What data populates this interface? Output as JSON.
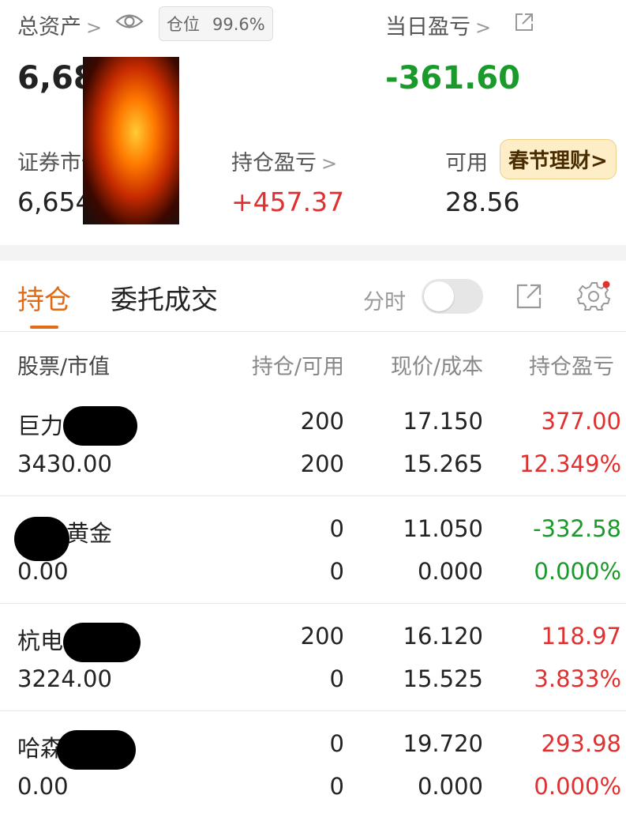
{
  "summary": {
    "total_assets_label": "总资产",
    "total_assets_value": "6,68",
    "position_label": "仓位",
    "position_value": "99.6%",
    "daily_pnl_label": "当日盈亏",
    "daily_pnl_value": "-361.60",
    "market_value_label": "证券市值",
    "market_value_value": "6,654",
    "holding_pnl_label": "持仓盈亏",
    "holding_pnl_value": "+457.37",
    "available_label": "可用",
    "available_value": "28.56",
    "promo_label": "春节理财"
  },
  "tabs": {
    "holdings": "持仓",
    "orders": "委托成交"
  },
  "controls": {
    "timeshare_label": "分时"
  },
  "table": {
    "headers": {
      "stock": "股票/市值",
      "position": "持仓/可用",
      "price": "现价/成本",
      "pnl": "持仓盈亏"
    },
    "rows": [
      {
        "name": "巨力",
        "market_value": "3430.00",
        "position": "200",
        "available": "200",
        "price": "17.150",
        "cost": "15.265",
        "pnl": "377.00",
        "pnl_pct": "12.349%",
        "color": "#e03030"
      },
      {
        "name": "黄金",
        "market_value": "0.00",
        "position": "0",
        "available": "0",
        "price": "11.050",
        "cost": "0.000",
        "pnl": "-332.58",
        "pnl_pct": "0.000%",
        "color": "#1a9a2a"
      },
      {
        "name": "杭电",
        "market_value": "3224.00",
        "position": "200",
        "available": "0",
        "price": "16.120",
        "cost": "15.525",
        "pnl": "118.97",
        "pnl_pct": "3.833%",
        "color": "#e03030"
      },
      {
        "name": "哈森",
        "market_value": "0.00",
        "position": "0",
        "available": "0",
        "price": "19.720",
        "cost": "0.000",
        "pnl": "293.98",
        "pnl_pct": "0.000%",
        "color": "#e03030"
      }
    ]
  },
  "colors": {
    "accent": "#e06a16",
    "gain": "#e03030",
    "loss": "#1a9a2a"
  },
  "icons": [
    "chevron-right-icon",
    "eye-icon",
    "external-link-icon",
    "share-icon",
    "settings-gear-icon"
  ]
}
